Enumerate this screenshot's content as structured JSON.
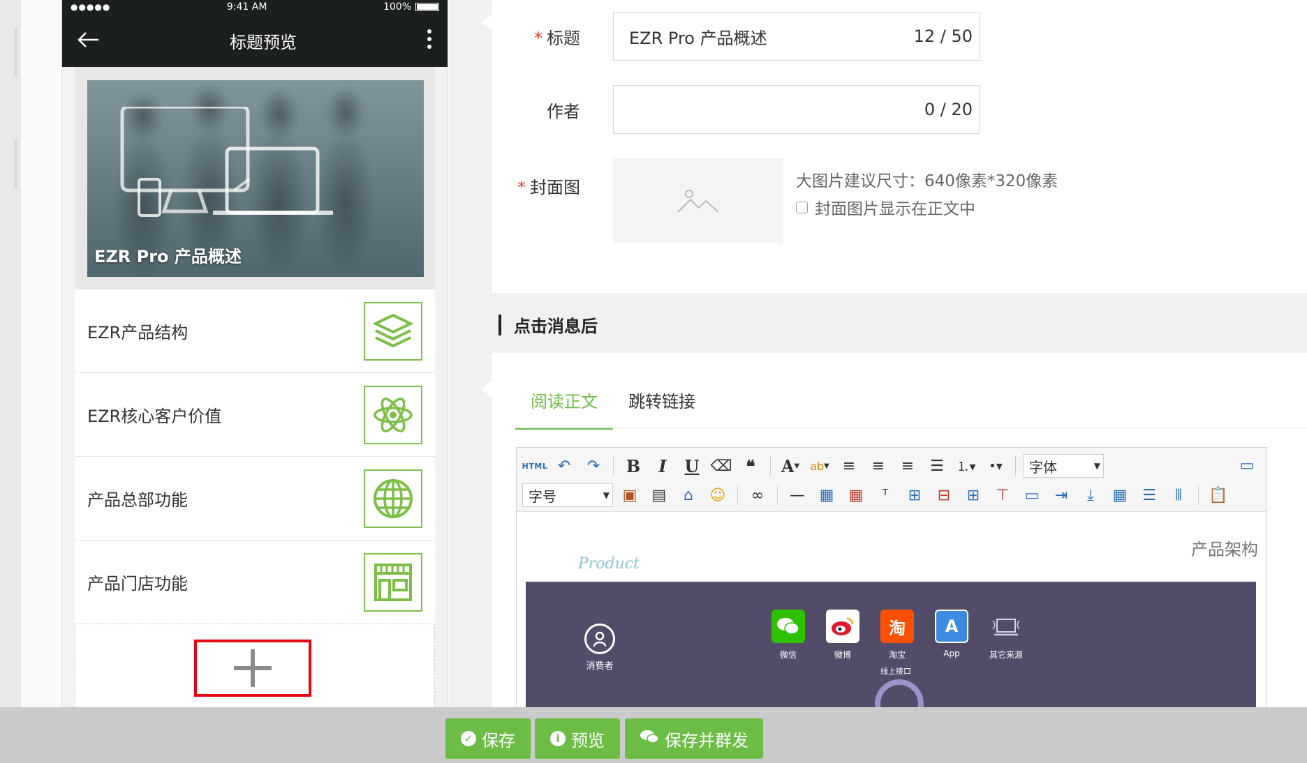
{
  "status_bar": {
    "signal": "●●●●●",
    "time": "9:41 AM",
    "battery": "100%"
  },
  "phone_nav": {
    "back_icon": "arrow-left-icon",
    "title": "标题预览",
    "more_icon": "more-vertical-icon"
  },
  "preview": {
    "cover_title": "EZR Pro 产品概述",
    "items": [
      {
        "label": "EZR产品结构",
        "icon": "layers-icon"
      },
      {
        "label": "EZR核心客户价值",
        "icon": "atom-icon"
      },
      {
        "label": "产品总部功能",
        "icon": "globe-icon"
      },
      {
        "label": "产品门店功能",
        "icon": "store-icon"
      }
    ],
    "add_icon": "plus-icon"
  },
  "form": {
    "title_label": "标题",
    "title_value": "EZR Pro 产品概述",
    "title_count": "12 / 50",
    "author_label": "作者",
    "author_value": "",
    "author_count": "0 / 20",
    "cover_label": "封面图",
    "cover_hint": "大图片建议尺寸：640像素*320像素",
    "cover_in_body_label": "封面图片显示在正文中",
    "required_mark": "*"
  },
  "after_click": {
    "section_title": "点击消息后",
    "tabs": [
      "阅读正文",
      "跳转链接"
    ],
    "active_tab": 0
  },
  "editor": {
    "html_btn": "HTML",
    "font_select": "字体",
    "size_select": "字号",
    "body_heading": "产品架构",
    "body_product": "Product",
    "arch": {
      "consumer": "消费者",
      "channels": [
        {
          "label": "微信",
          "glyph": "",
          "color": "#2dc100"
        },
        {
          "label": "微博",
          "glyph": "",
          "color": "#ffffff"
        },
        {
          "label": "淘宝",
          "glyph": "淘",
          "color": "#ff5000"
        },
        {
          "label": "App",
          "glyph": "A",
          "color": "#3d8be0"
        },
        {
          "label": "其它来源",
          "glyph": "",
          "color": "#524c69"
        }
      ],
      "online_api": "线上接口"
    }
  },
  "actions": {
    "save": "保存",
    "preview": "预览",
    "save_send": "保存并群发"
  },
  "colors": {
    "accent": "#6cbd45",
    "highlight_border": "#e60012",
    "arch_bg": "#524c69",
    "nav_bg": "#1c1f1f"
  }
}
